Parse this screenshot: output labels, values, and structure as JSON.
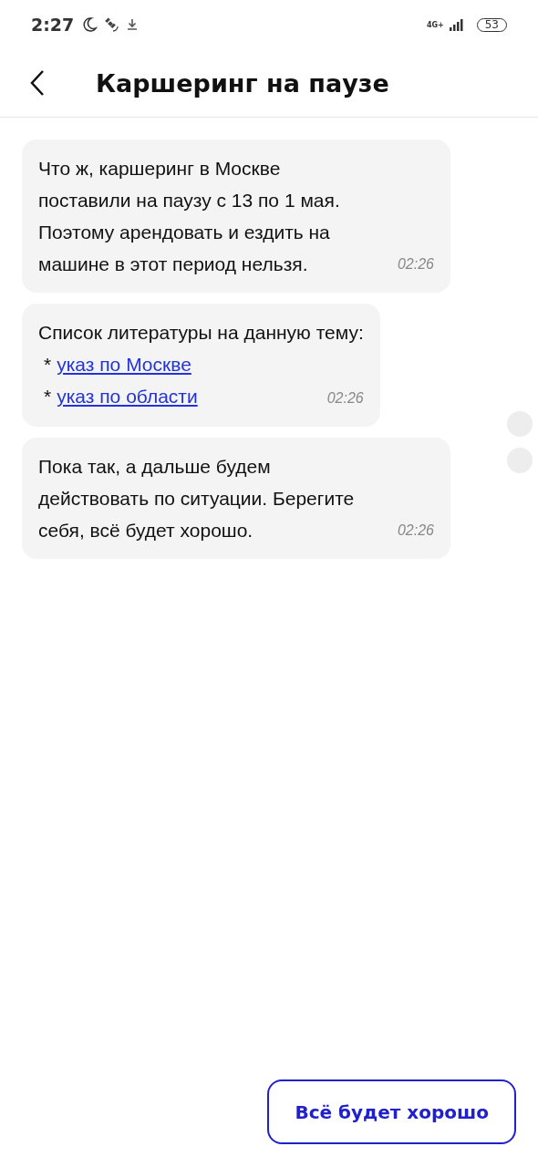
{
  "status_bar": {
    "time": "2:27",
    "network": "4G+",
    "battery": "53"
  },
  "header": {
    "title": "Каршеринг на паузе"
  },
  "messages": [
    {
      "kind": "text",
      "text": "Что ж, каршеринг в Москве поставили на паузу с 13 по 1 мая. Поэтому арендовать и ездить на машине в этот период нельзя.",
      "time": "02:26"
    },
    {
      "kind": "links",
      "text": "Список литературы на данную тему:",
      "links": [
        {
          "bullet": "*",
          "label": "указ по Москве"
        },
        {
          "bullet": "*",
          "label": "указ по области"
        }
      ],
      "time": "02:26"
    },
    {
      "kind": "text",
      "text": "Пока так, а дальше будем действовать по ситуации. Берегите себя, всё будет хорошо.",
      "time": "02:26"
    }
  ],
  "reply_button": {
    "label": "Всё будет хорошо"
  }
}
